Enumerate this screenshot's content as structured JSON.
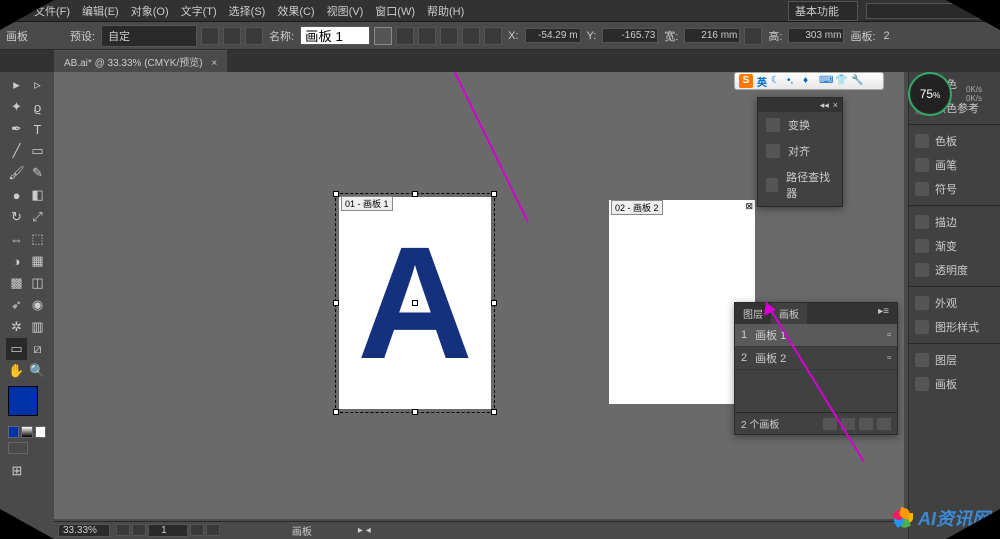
{
  "menu": {
    "items": [
      "文件(F)",
      "编辑(E)",
      "对象(O)",
      "文字(T)",
      "选择(S)",
      "效果(C)",
      "视图(V)",
      "窗口(W)",
      "帮助(H)"
    ],
    "workspace": "基本功能"
  },
  "control": {
    "mode_label": "画板",
    "preset_label": "预设:",
    "preset_value": "自定",
    "name_label": "名称:",
    "name_value": "画板 1",
    "x_label": "X:",
    "x_value": "-54.29 m",
    "y_label": "Y:",
    "y_value": "-165.73",
    "w_label": "宽:",
    "w_value": "216 mm",
    "h_label": "高:",
    "h_value": "303 mm",
    "artboards_label": "画板:",
    "artboards_value": "2"
  },
  "tab": {
    "title": "AB.ai* @ 33.33% (CMYK/预览)"
  },
  "artboard1": {
    "label": "01 - 画板 1",
    "letter": "A"
  },
  "artboard2": {
    "label": "02 - 画板 2"
  },
  "right_panels": {
    "items": [
      "颜色",
      "颜色参考",
      "色板",
      "画笔",
      "符号",
      "描边",
      "渐变",
      "透明度",
      "外观",
      "图形样式",
      "图层",
      "画板"
    ]
  },
  "transform_panel": {
    "items": [
      "变换",
      "对齐",
      "路径查找器"
    ]
  },
  "artboards_panel": {
    "tabs": [
      "图层",
      "画板"
    ],
    "active_tab": 1,
    "rows": [
      {
        "num": "1",
        "name": "画板 1"
      },
      {
        "num": "2",
        "name": "画板 2"
      }
    ],
    "footer": "2 个画板"
  },
  "ime": {
    "badge": "S",
    "label": "英"
  },
  "meter": {
    "value": "75",
    "unit": "%",
    "lines": [
      "0K/s",
      "0K/s"
    ]
  },
  "status": {
    "zoom": "33.33%",
    "nav_value": "1",
    "tool": "画板"
  },
  "watermark": {
    "text": "AI资讯网"
  }
}
